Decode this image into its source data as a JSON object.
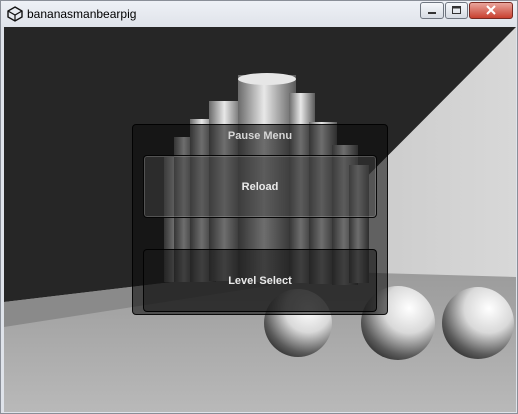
{
  "window": {
    "title": "bananasmanbearpig",
    "icons": {
      "app": "unity-logo-icon",
      "minimize": "minimize-icon",
      "maximize": "maximize-icon",
      "close": "close-icon"
    }
  },
  "pause_menu": {
    "title": "Pause Menu",
    "buttons": [
      {
        "label": "Reload"
      },
      {
        "label": "Level Select"
      }
    ]
  },
  "colors": {
    "close_button": "#c8402f",
    "menu_background": "rgba(10,10,10,0.55)"
  }
}
